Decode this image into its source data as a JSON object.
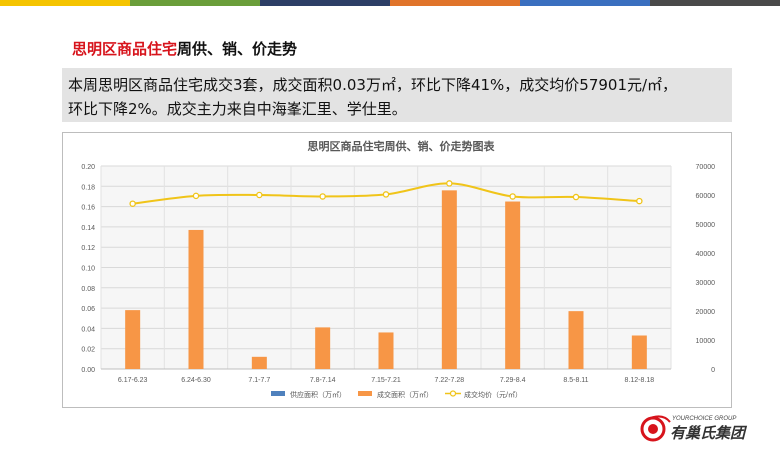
{
  "page": {
    "heading_red": "思明区商品住宅",
    "heading_rest": "周供、销、价走势",
    "summary_line1": "本周思明区商品住宅成交3套，成交面积0.03万㎡，环比下降41%，成交均价57901元/㎡，",
    "summary_line2": "环比下降2%。成交主力来自中海峯汇里、学仕里。",
    "top_bar_colors": [
      "#f5c400",
      "#6a9e3a",
      "#2c3e66",
      "#e0742a",
      "#3a6fbf",
      "#4a4a4a"
    ]
  },
  "logo": {
    "en_text": "YOURCHOICE GROUP",
    "cn_text": "有巢氏集团",
    "accent": "#d7141c"
  },
  "chart_data": {
    "type": "bar",
    "title": "思明区商品住宅周供、销、价走势图表",
    "categories": [
      "6.17-6.23",
      "6.24-6.30",
      "7.1-7.7",
      "7.8-7.14",
      "7.15-7.21",
      "7.22-7.28",
      "7.29-8.4",
      "8.5-8.11",
      "8.12-8.18"
    ],
    "series": [
      {
        "name": "供应面积（万㎡）",
        "kind": "bar",
        "axis": "left",
        "color": "#4f81bd",
        "values": [
          0,
          0,
          0,
          0,
          0,
          0,
          0,
          0,
          0
        ]
      },
      {
        "name": "成交面积（万㎡）",
        "kind": "bar",
        "axis": "left",
        "color": "#f79646",
        "values": [
          0.058,
          0.137,
          0.012,
          0.041,
          0.036,
          0.176,
          0.165,
          0.057,
          0.033
        ]
      },
      {
        "name": "成交均价（元/㎡）",
        "kind": "line",
        "axis": "right",
        "color": "#f0c419",
        "values": [
          57000,
          59700,
          60000,
          59500,
          60200,
          64000,
          59500,
          59300,
          57901
        ]
      }
    ],
    "y_left": {
      "min": 0,
      "max": 0.2,
      "step": 0.02,
      "ticks": [
        "0.00",
        "0.02",
        "0.04",
        "0.06",
        "0.08",
        "0.10",
        "0.12",
        "0.14",
        "0.16",
        "0.18",
        "0.20"
      ]
    },
    "y_right": {
      "min": 0,
      "max": 70000,
      "step": 10000,
      "ticks": [
        "0",
        "10000",
        "20000",
        "30000",
        "40000",
        "50000",
        "60000",
        "70000"
      ]
    },
    "grid": true,
    "legend_position": "bottom"
  }
}
